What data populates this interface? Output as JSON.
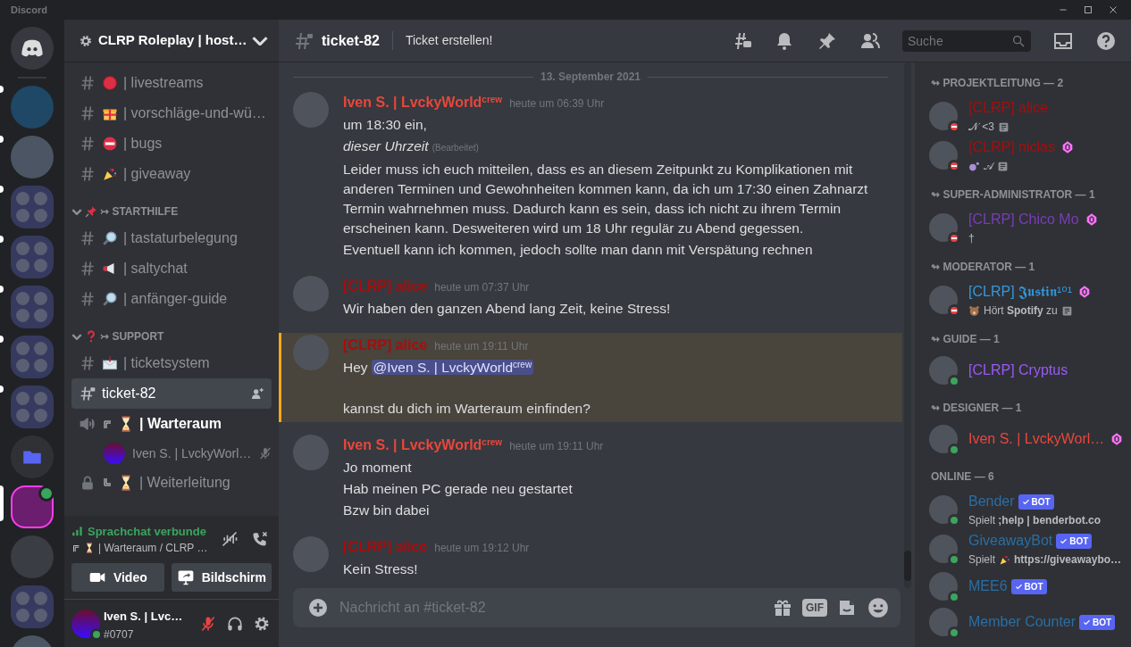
{
  "window": {
    "title": "Discord"
  },
  "servers": [
    {
      "kind": "home",
      "selected": false,
      "unread": false,
      "in_voice": false
    },
    {
      "kind": "server",
      "selected": false,
      "unread": true,
      "in_voice": false
    },
    {
      "kind": "server",
      "selected": false,
      "unread": true,
      "in_voice": false
    },
    {
      "kind": "folder",
      "selected": false,
      "unread": true,
      "in_voice": false
    },
    {
      "kind": "folder",
      "selected": false,
      "unread": true,
      "in_voice": false
    },
    {
      "kind": "folder",
      "selected": false,
      "unread": true,
      "in_voice": false
    },
    {
      "kind": "folder",
      "selected": false,
      "unread": true,
      "in_voice": false
    },
    {
      "kind": "folder",
      "selected": false,
      "unread": true,
      "in_voice": false
    },
    {
      "kind": "open-folder",
      "selected": false,
      "unread": false,
      "in_voice": false
    },
    {
      "kind": "server",
      "selected": true,
      "in_voice": true
    },
    {
      "kind": "server",
      "selected": false,
      "unread": false,
      "in_voice": false
    },
    {
      "kind": "folder",
      "selected": false,
      "unread": false,
      "in_voice": false
    },
    {
      "kind": "server",
      "selected": false,
      "unread": false,
      "in_voice": false
    }
  ],
  "server_header": {
    "name": "CLRP Roleplay | host…"
  },
  "channel_groups": [
    {
      "channels": [
        {
          "kind": "text",
          "name": "| livestreams",
          "selected": false,
          "unread": false
        },
        {
          "kind": "text",
          "name": "| vorschläge-und-wü…",
          "selected": false,
          "unread": false
        },
        {
          "kind": "text",
          "name": "| bugs",
          "selected": false,
          "unread": false
        },
        {
          "kind": "text",
          "name": "| giveaway",
          "selected": false,
          "unread": false
        }
      ]
    },
    {
      "category": "↣ STARTHILFE",
      "expanded": true,
      "channels": [
        {
          "kind": "text",
          "name": "| tastaturbelegung",
          "selected": false,
          "unread": false
        },
        {
          "kind": "text",
          "name": "| saltychat",
          "selected": false,
          "unread": false
        },
        {
          "kind": "text",
          "name": "| anfänger-guide",
          "selected": false,
          "unread": false
        }
      ]
    },
    {
      "category": "↣ SUPPORT",
      "expanded": true,
      "channels": [
        {
          "kind": "text",
          "name": "| ticketsystem",
          "selected": false,
          "unread": false
        },
        {
          "kind": "private",
          "name": "ticket-82",
          "selected": true,
          "unread": false
        },
        {
          "kind": "voice",
          "name": "| Warteraum",
          "selected": false,
          "unread": true,
          "users": [
            {
              "name": "Iven S. | LvckyWorl…",
              "muted": true
            }
          ]
        },
        {
          "kind": "locked-voice",
          "name": "| Weiterleitung",
          "selected": false,
          "unread": false
        }
      ]
    }
  ],
  "voice_panel": {
    "status": "Sprachchat verbunde",
    "channel": "| Warteraum / CLRP …",
    "buttons": [
      {
        "kind": "video",
        "label": "Video"
      },
      {
        "kind": "screen",
        "label": "Bildschirm"
      }
    ]
  },
  "user_panel": {
    "name": "Iven S. | Lvc…",
    "tag": "#0707",
    "dnd": false,
    "muted": true
  },
  "chat": {
    "channel": "ticket-82",
    "topic": "Ticket erstellen!",
    "search": {
      "placeholder": "Suche"
    },
    "date_divider": "13. September 2021",
    "messages": [
      {
        "author": "Iven S. | LvckyWorld$^{crew}$",
        "color": "#e8473b",
        "time": "heute um 06:39 Uhr",
        "highlighted": false,
        "lines": [
          {
            "kind": "text",
            "text": "um 18:30 ein,"
          },
          {
            "kind": "italic",
            "text": "dieser Uhrzeit",
            "edited": "(Bearbeitet)"
          },
          {
            "kind": "text",
            "text": "Leider muss ich euch mitteilen, dass es an diesem Zeitpunkt zu Komplikationen mit anderen Terminen und Gewohnheiten kommen kann, da ich um 17:30 einen Zahnarzt Termin wahrnehmen muss. Dadurch kann es sein, dass ich nicht zu ihrem Termin erscheinen kann. Desweiteren wird um 18 Uhr regulär zu Abend gegessen."
          },
          {
            "kind": "text",
            "text": "Eventuell kann ich kommen, jedoch sollte man dann mit Verspätung rechnen"
          }
        ]
      },
      {
        "author": "[CLRP] alice",
        "color": "#a80d0d",
        "time": "heute um 07:37 Uhr",
        "highlighted": false,
        "lines": [
          {
            "kind": "text",
            "text": "Wir haben den ganzen Abend lang Zeit, keine Stress!"
          }
        ]
      },
      {
        "author": "[CLRP] alice",
        "color": "#a80d0d",
        "time": "heute um 19:11 Uhr",
        "highlighted": true,
        "lines": [
          {
            "kind": "mention",
            "text": "Hey",
            "mention": "@Iven S. | LvckyWorld$^{crew}$"
          },
          {
            "kind": "spacer"
          },
          {
            "kind": "text",
            "text": "kannst du dich im Warteraum einfinden?"
          }
        ]
      },
      {
        "author": "Iven S. | LvckyWorld$^{crew}$",
        "color": "#e8473b",
        "time": "heute um 19:11 Uhr",
        "highlighted": false,
        "lines": [
          {
            "kind": "text",
            "text": "Jo moment"
          },
          {
            "kind": "text",
            "text": "Hab meinen PC gerade neu gestartet"
          },
          {
            "kind": "text",
            "text": "Bzw bin dabei"
          }
        ]
      },
      {
        "author": "[CLRP] alice",
        "color": "#a80d0d",
        "time": "heute um 19:12 Uhr",
        "highlighted": false,
        "lines": [
          {
            "kind": "text",
            "text": "Kein Stress!"
          }
        ]
      }
    ],
    "composer": {
      "placeholder": "Nachricht an #ticket-82",
      "gif_label": "GIF"
    }
  },
  "members": {
    "groups": [
      {
        "title": "↬ PROJEKTLEITUNG — 2",
        "members": [
          {
            "name": "[CLRP] alice",
            "color": "#a80d0d",
            "dnd": true,
            "boosting": false,
            "activity": [
              {
                "kind": "text",
                "text": "𝒩 <3"
              },
              {
                "kind": "note"
              }
            ]
          },
          {
            "name": "[CLRP] niclas",
            "color": "#a80d0d",
            "dnd": true,
            "boosting": true,
            "activity": [
              {
                "kind": "emoji"
              },
              {
                "kind": "text",
                "text": "𝒜"
              },
              {
                "kind": "note"
              }
            ]
          }
        ]
      },
      {
        "title": "↬ SUPER-ADMINISTRATOR — 1",
        "members": [
          {
            "name": "[CLRP] Chico Mo",
            "color": "#7a3db5",
            "dnd": true,
            "boosting": true,
            "activity": [
              {
                "kind": "text",
                "text": "†"
              }
            ]
          }
        ]
      },
      {
        "title": "↬ MODERATOR — 1",
        "members": [
          {
            "name": "[CLRP] 𝕵𝖚𝖘𝖙𝖎𝖓¹⁰¹",
            "color": "#3498db",
            "dnd": true,
            "boosting": true,
            "activity": [
              {
                "kind": "emoji"
              },
              {
                "kind": "text",
                "text": "Hört **Spotify** zu"
              },
              {
                "kind": "note"
              }
            ]
          }
        ]
      },
      {
        "title": "↬ GUIDE — 1",
        "members": [
          {
            "name": "[CLRP] Cryptus",
            "color": "#9b59f6",
            "dnd": false,
            "boosting": false
          }
        ]
      },
      {
        "title": "↬ DESIGNER — 1",
        "members": [
          {
            "name": "Iven S. | LvckyWorl…",
            "color": "#e8473b",
            "dnd": false,
            "boosting": true
          }
        ]
      },
      {
        "title": "ONLINE — 6",
        "members": [
          {
            "name": "Bender",
            "color": "#2a6ea3",
            "dnd": false,
            "boosting": false,
            "tag": "BOT",
            "activity": [
              {
                "kind": "text",
                "text": "Spielt **;help | benderbot.co**"
              }
            ]
          },
          {
            "name": "GiveawayBot",
            "color": "#2a6ea3",
            "dnd": false,
            "boosting": false,
            "tag": "BOT",
            "activity": [
              {
                "kind": "text",
                "text": "Spielt"
              },
              {
                "kind": "emoji"
              },
              {
                "kind": "text",
                "text": "**https://giveawaybo…**"
              }
            ]
          },
          {
            "name": "MEE6",
            "color": "#2a6ea3",
            "dnd": false,
            "boosting": false,
            "tag": "BOT"
          },
          {
            "name": "Member Counter",
            "color": "#2a6ea3",
            "dnd": false,
            "boosting": false,
            "tag": "BOT"
          }
        ]
      }
    ]
  }
}
